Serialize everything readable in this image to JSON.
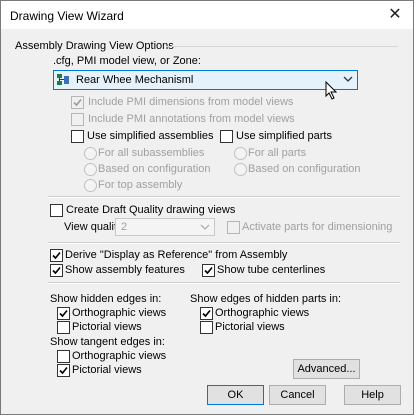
{
  "window": {
    "title": "Drawing View Wizard"
  },
  "group": {
    "title": "Assembly Drawing View Options",
    "zone_label": ".cfg, PMI model view, or Zone:",
    "zone_value": "Rear Whee Mechanisml",
    "icons": {
      "config": "configuration-icon",
      "dropdown": "chevron-down-icon",
      "cursor": "mouse-pointer-icon"
    }
  },
  "options": {
    "include_pmi_dimensions": {
      "label": "Include PMI dimensions from model views",
      "checked": true,
      "enabled": false
    },
    "include_pmi_annotations": {
      "label": "Include PMI annotations from model views",
      "checked": false,
      "enabled": false
    },
    "use_simplified_assemblies": {
      "label": "Use simplified assemblies",
      "checked": false
    },
    "use_simplified_parts": {
      "label": "Use simplified parts",
      "checked": false
    },
    "for_all_subassemblies": {
      "label": "For all subassemblies"
    },
    "based_on_configuration_left": {
      "label": "Based on configuration"
    },
    "for_top_assembly": {
      "label": "For top assembly"
    },
    "for_all_parts": {
      "label": "For all parts"
    },
    "based_on_configuration_right": {
      "label": "Based on configuration"
    }
  },
  "draft": {
    "create_draft_quality": {
      "label": "Create Draft Quality drawing views",
      "checked": false
    },
    "view_quality_label": "View quality:",
    "view_quality_value": "2",
    "activate_parts": {
      "label": "Activate parts for dimensioning",
      "checked": false
    }
  },
  "display": {
    "derive_display": {
      "label": "Derive \"Display as Reference\" from Assembly",
      "checked": true
    },
    "show_assembly_features": {
      "label": "Show assembly features",
      "checked": true
    },
    "show_tube_centerlines": {
      "label": "Show tube centerlines",
      "checked": true
    }
  },
  "edges": {
    "hidden_edges_heading": "Show hidden edges in:",
    "hidden_orthographic": {
      "label": "Orthographic views",
      "checked": true
    },
    "hidden_pictorial": {
      "label": "Pictorial views",
      "checked": false
    },
    "hidden_parts_heading": "Show edges of hidden parts in:",
    "parts_orthographic": {
      "label": "Orthographic views",
      "checked": true
    },
    "parts_pictorial": {
      "label": "Pictorial views",
      "checked": false
    },
    "tangent_heading": "Show tangent edges in:",
    "tangent_orthographic": {
      "label": "Orthographic views",
      "checked": false
    },
    "tangent_pictorial": {
      "label": "Pictorial views",
      "checked": true
    }
  },
  "buttons": {
    "advanced": "Advanced...",
    "ok": "OK",
    "cancel": "Cancel",
    "help": "Help"
  },
  "colors": {
    "accent": "#0078d7",
    "combo_bg": "#e5f1fb",
    "dialog_bg": "#f0f0f0"
  }
}
